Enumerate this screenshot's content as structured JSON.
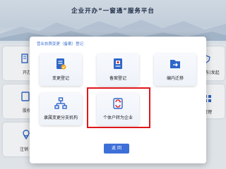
{
  "banner": {
    "title": "企业开办“一窗通”服务平台"
  },
  "background_tiles": [
    {
      "label": "开办"
    },
    {
      "label": "股权"
    },
    {
      "label": "注销"
    },
    {
      "label": "(股东(发起"
    },
    {
      "label": "管理"
    }
  ],
  "modal": {
    "title": "营业执照变更（备案）登记",
    "options": [
      {
        "label": "变更登记",
        "icon": "document-edit-icon"
      },
      {
        "label": "备案登记",
        "icon": "document-stamp-icon"
      },
      {
        "label": "编内迁移",
        "icon": "file-transfer-icon"
      },
      {
        "label": "隶属变更分支机构",
        "icon": "org-tree-icon"
      },
      {
        "label": "个体户转为企业",
        "icon": "convert-enterprise-icon"
      }
    ],
    "back_label": "返 回",
    "highlight_color": "#e0161b",
    "accent_color": "#3d6fd8"
  }
}
